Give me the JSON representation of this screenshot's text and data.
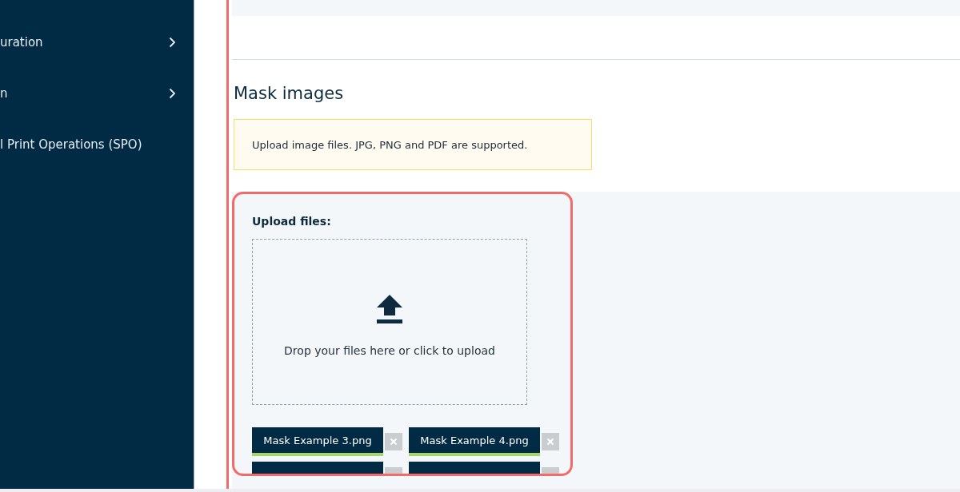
{
  "sidebar": {
    "items": [
      {
        "label": "uration",
        "has_submenu": true
      },
      {
        "label": "n",
        "has_submenu": true
      },
      {
        "label": "l Print Operations (SPO)",
        "has_submenu": false
      }
    ]
  },
  "section": {
    "title": "Mask images",
    "notice": "Upload image files. JPG, PNG and PDF are supported."
  },
  "upload": {
    "label": "Upload files:",
    "dropzone_text": "Drop your files here or click to upload",
    "files": [
      {
        "name": "Mask Example 3.png",
        "uploaded": true
      },
      {
        "name": "Mask Example 4.png",
        "uploaded": true
      }
    ]
  }
}
